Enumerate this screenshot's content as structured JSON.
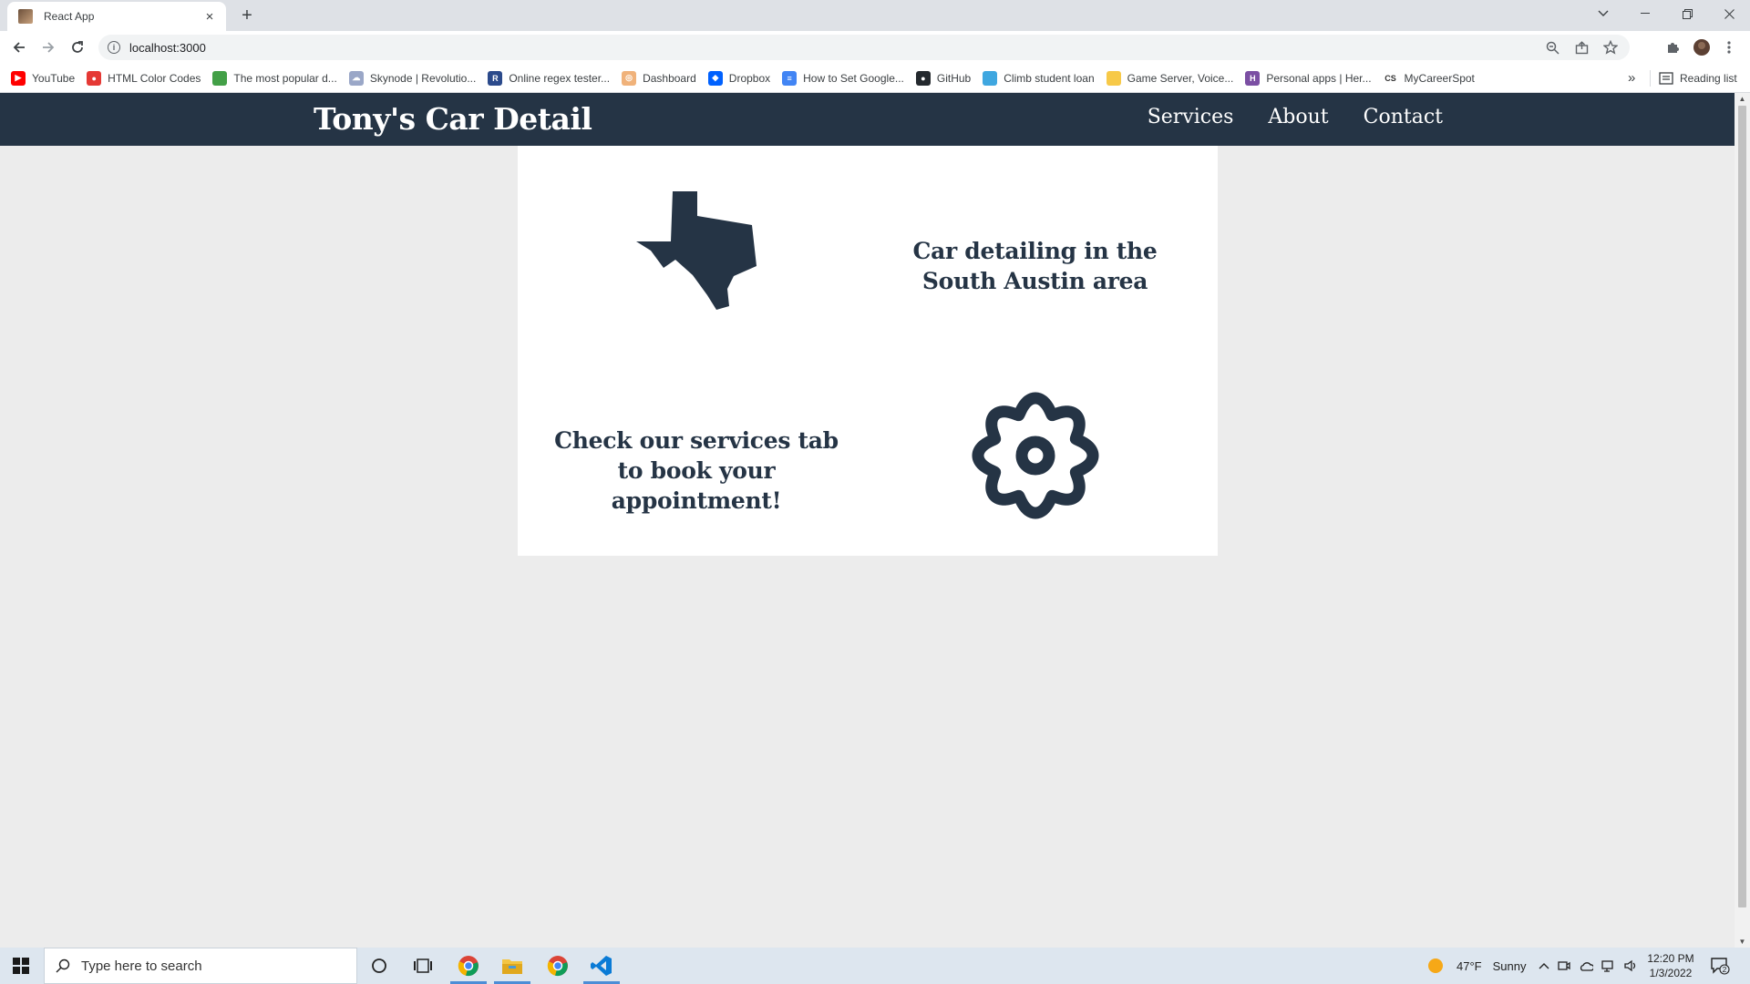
{
  "browser": {
    "tab_title": "React App",
    "tab_close": "×",
    "new_tab": "+",
    "url": "localhost:3000",
    "bookmarks": [
      {
        "label": "YouTube",
        "color": "#ff0000",
        "glyph": "▶"
      },
      {
        "label": "HTML Color Codes",
        "color": "#e53935",
        "glyph": "●"
      },
      {
        "label": "The most popular d...",
        "color": "#43a047",
        "glyph": ""
      },
      {
        "label": "Skynode | Revolutio...",
        "color": "#9aa7c7",
        "glyph": "☁"
      },
      {
        "label": "Online regex tester...",
        "color": "#2b4a8b",
        "glyph": "R"
      },
      {
        "label": "Dashboard",
        "color": "#f0b27a",
        "glyph": "◎"
      },
      {
        "label": "Dropbox",
        "color": "#0061fe",
        "glyph": "◆"
      },
      {
        "label": "How to Set Google...",
        "color": "#4285f4",
        "glyph": "≡"
      },
      {
        "label": "GitHub",
        "color": "#24292e",
        "glyph": "●"
      },
      {
        "label": "Climb student loan",
        "color": "#3fa7e0",
        "glyph": ""
      },
      {
        "label": "Game Server, Voice...",
        "color": "#f7c948",
        "glyph": ""
      },
      {
        "label": "Personal apps | Her...",
        "color": "#7b4fa3",
        "glyph": "H"
      },
      {
        "label": "MyCareerSpot",
        "color": "#ffffff",
        "glyph": "CS"
      }
    ],
    "bookmarks_more": "»",
    "reading_list": "Reading list"
  },
  "site": {
    "brand": "Tony's Car Detail",
    "nav": [
      "Services",
      "About",
      "Contact"
    ],
    "tagline_location": "Car detailing in the South Austin area",
    "tagline_booking": "Check our services tab to book your appointment!",
    "brand_color": "#253445"
  },
  "taskbar": {
    "search_placeholder": "Type here to search",
    "weather_temp": "47°F",
    "weather_text": "Sunny",
    "time": "12:20 PM",
    "date": "1/3/2022",
    "notifications": "2"
  },
  "icons": [
    "texas-map-icon",
    "gear-icon"
  ]
}
